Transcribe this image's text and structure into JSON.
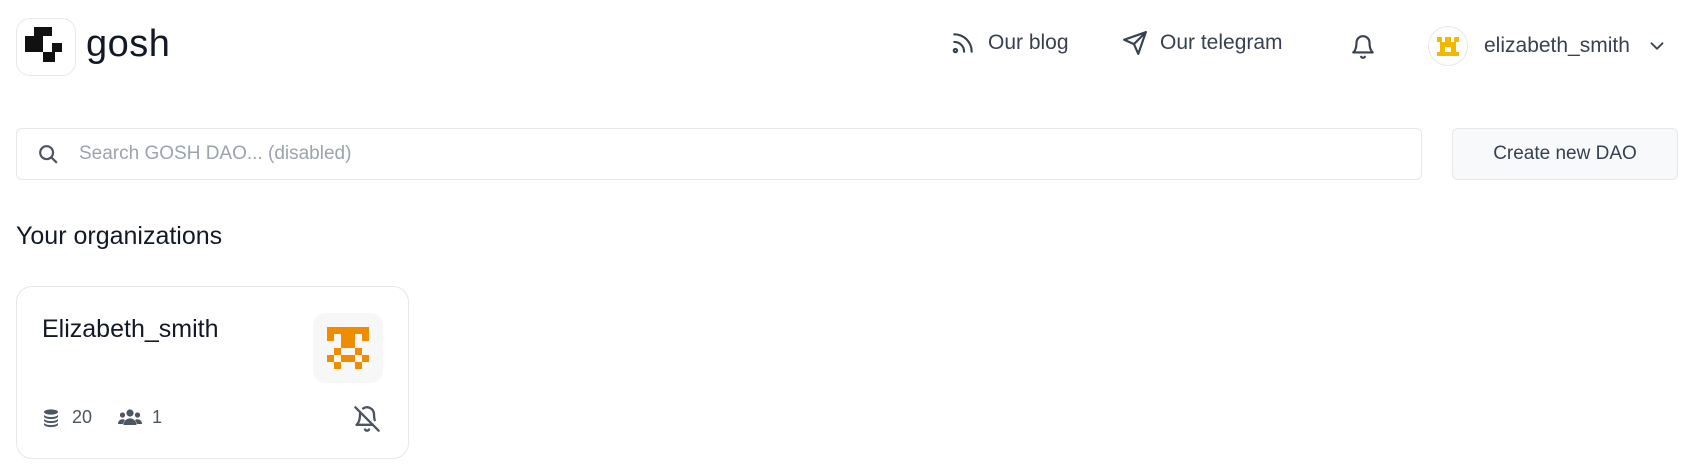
{
  "header": {
    "logo_text": "gosh",
    "nav": {
      "blog_label": "Our blog",
      "telegram_label": "Our telegram"
    },
    "user": {
      "name": "elizabeth_smith"
    }
  },
  "search": {
    "placeholder": "Search GOSH DAO... (disabled)"
  },
  "create_button_label": "Create new DAO",
  "section_title": "Your organizations",
  "organizations": [
    {
      "name": "Elizabeth_smith",
      "repositories": "20",
      "members": "1"
    }
  ],
  "colors": {
    "user_avatar": "#f5b800",
    "org_avatar": "#f08c00",
    "text_muted": "#9ca3af",
    "border": "#e5e7eb"
  }
}
